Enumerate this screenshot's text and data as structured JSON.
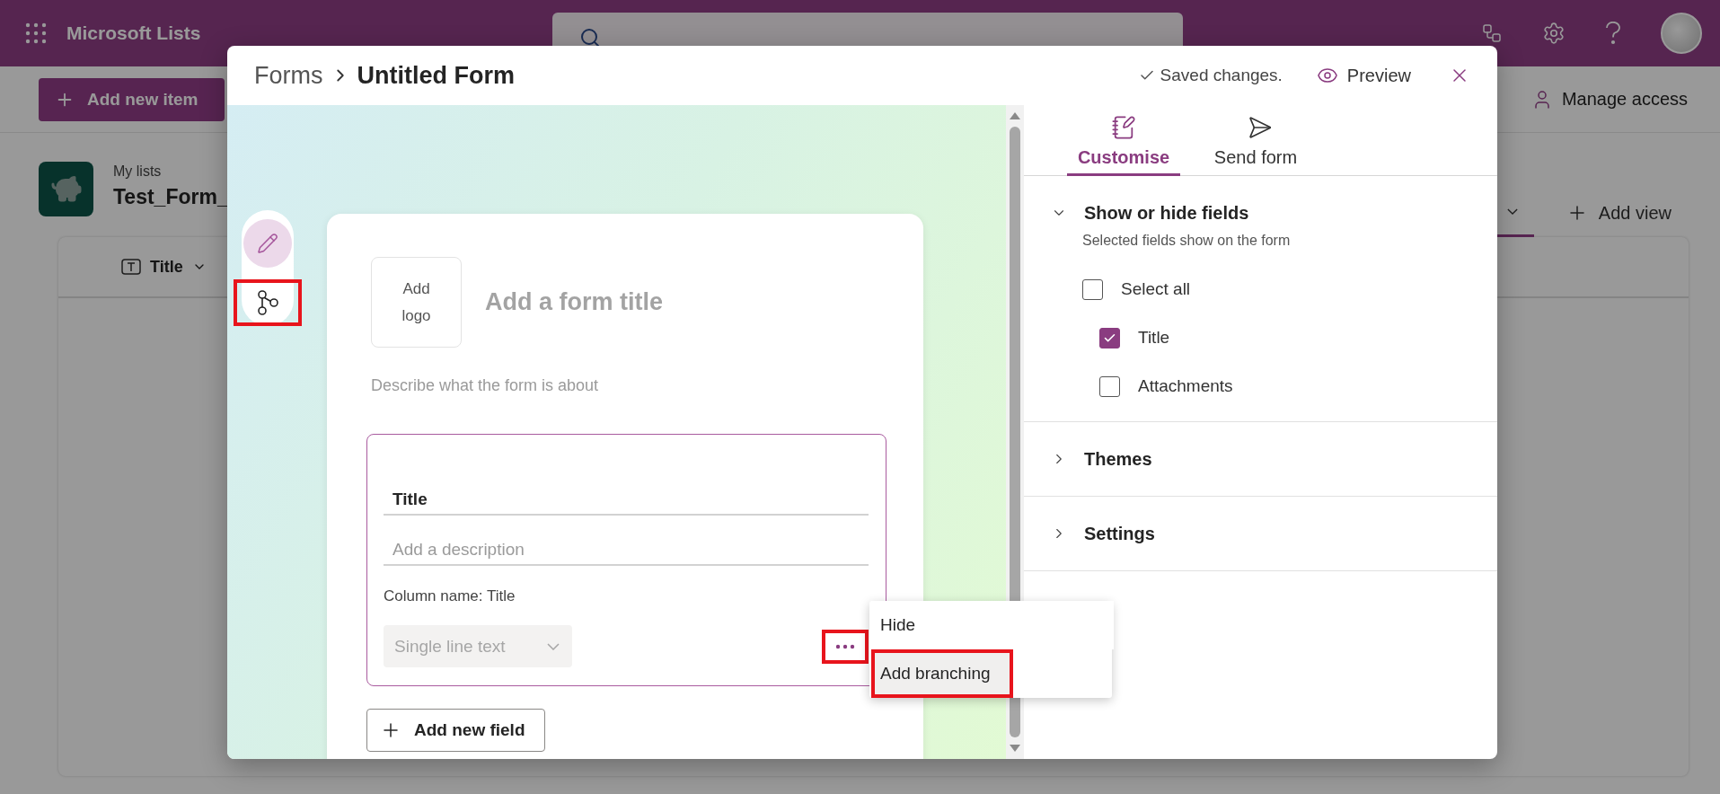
{
  "app_bar": {
    "app_name": "Microsoft Lists"
  },
  "command_bar": {
    "add_button": "Add new item",
    "manage_access": "Manage access"
  },
  "list_header": {
    "breadcrumb": "My lists",
    "title": "Test_Form_",
    "add_view": "Add view"
  },
  "grid": {
    "columns": [
      {
        "label": "Title"
      }
    ]
  },
  "dialog": {
    "breadcrumb": [
      {
        "label": "Forms"
      },
      {
        "label": "Untitled Form"
      }
    ],
    "save_status": "Saved changes.",
    "preview": "Preview",
    "rail": [
      {
        "kind": "edit",
        "selected": true,
        "highlighted": false
      },
      {
        "kind": "branching",
        "selected": false,
        "highlighted": true
      }
    ],
    "form": {
      "logo_placeholder": "Add logo",
      "title_placeholder": "Add a form title",
      "description_placeholder": "Describe what the form is about",
      "question": {
        "title": "Title",
        "description_placeholder": "Add a description",
        "column_name": "Column name: Title",
        "type": "Single line text",
        "more_highlighted": true
      },
      "add_field": "Add new field"
    },
    "context_menu": [
      {
        "label": "Hide",
        "hovered": false,
        "highlighted": false
      },
      {
        "label": "Add branching",
        "hovered": true,
        "highlighted": true
      }
    ],
    "panel": {
      "tabs": [
        {
          "label": "Customise",
          "kind": "customise",
          "selected": true
        },
        {
          "label": "Send form",
          "kind": "send",
          "selected": false
        }
      ],
      "sections": [
        {
          "title": "Show or hide fields",
          "expanded": true,
          "hint": "Selected fields show on the form",
          "fields": [
            {
              "label": "Select all",
              "checked": false,
              "children": [
                {
                  "label": "Title",
                  "checked": true
                },
                {
                  "label": "Attachments",
                  "checked": false
                }
              ]
            }
          ]
        },
        {
          "title": "Themes",
          "expanded": false
        },
        {
          "title": "Settings",
          "expanded": false
        }
      ]
    }
  }
}
